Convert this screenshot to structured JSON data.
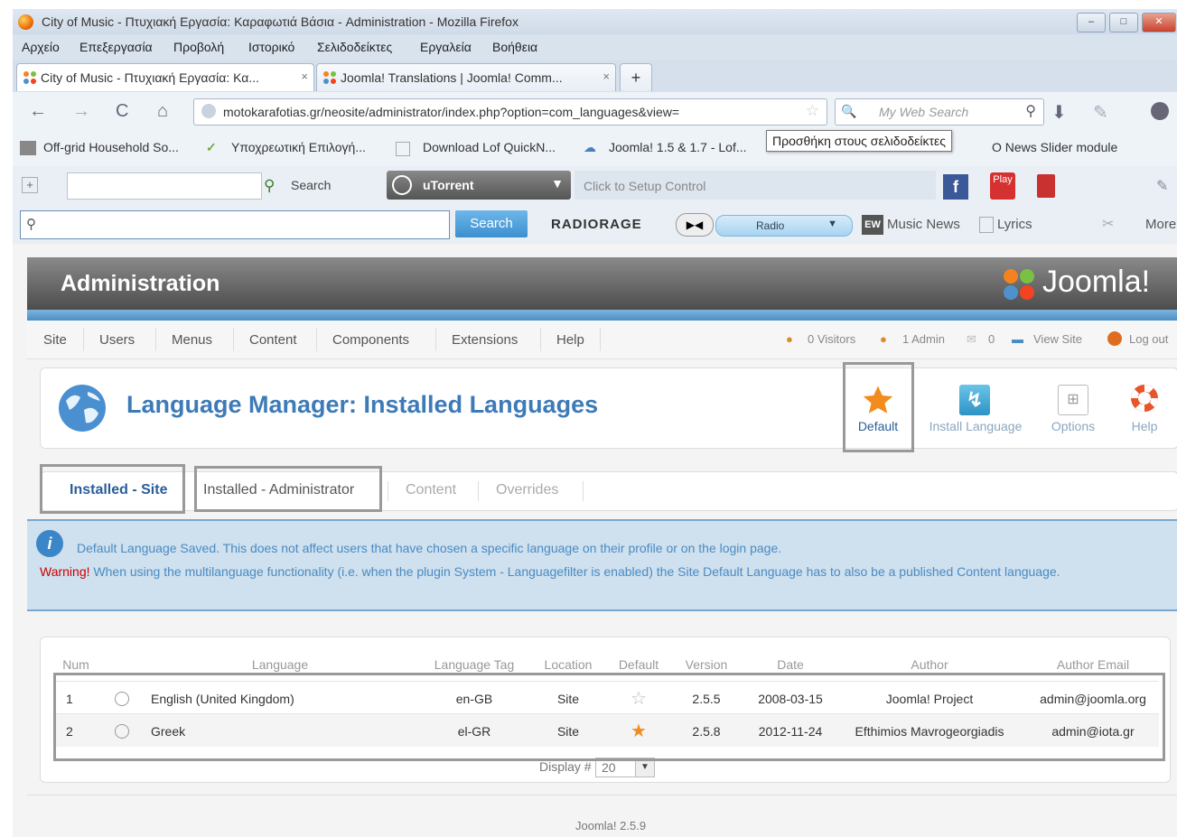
{
  "window": {
    "title": "City of Music - Πτυχιακή Εργασία: Καραφωτιά Βάσια - Administration - Mozilla Firefox"
  },
  "menubar": {
    "items": [
      "Αρχείο",
      "Επεξεργασία",
      "Προβολή",
      "Ιστορικό",
      "Σελιδοδείκτες",
      "Εργαλεία",
      "Βοήθεια"
    ]
  },
  "tabs": [
    {
      "label": "City of Music - Πτυχιακή Εργασία: Κα...",
      "close": "×"
    },
    {
      "label": "Joomla! Translations | Joomla! Comm...",
      "close": "×"
    },
    {
      "label": "+"
    }
  ],
  "navbar": {
    "back_icon": "←",
    "forward_icon": "→",
    "reload_icon": "C",
    "home_icon": "⌂",
    "url": "motokarafotias.gr/neosite/administrator/index.php?option=com_languages&view=",
    "search_placeholder": "My Web Search"
  },
  "bookmarks": {
    "items": [
      "Off-grid Household So...",
      "Υποχρεωτική Επιλογή...",
      "Download Lof QuickN...",
      "Joomla! 1.5 & 1.7 - Lof...",
      "O News Slider module"
    ],
    "tooltip": "Προσθήκη στους σελιδοδείκτες"
  },
  "toolbar1": {
    "search_label": "Search",
    "utorrent_label": "uTorrent",
    "setup_text": "Click to Setup Control",
    "play_label": "Play"
  },
  "toolbar2": {
    "search_button": "Search",
    "radiorage": "RADIORAGE",
    "radio_label": "Radio",
    "music_news": "Music News",
    "lyrics": "Lyrics",
    "more": "More"
  },
  "admin": {
    "header_title": "Administration",
    "logo_text": "Joomla!",
    "menu": [
      "Site",
      "Users",
      "Menus",
      "Content",
      "Components",
      "Extensions",
      "Help"
    ],
    "status": {
      "visitors": "0 Visitors",
      "admin": "1 Admin",
      "messages": "0",
      "view_site": "View Site",
      "logout": "Log out"
    },
    "page_title": "Language Manager: Installed Languages",
    "toolbar": {
      "default": "Default",
      "install": "Install Language",
      "options": "Options",
      "help": "Help"
    },
    "subtabs": [
      "Installed - Site",
      "Installed - Administrator",
      "Content",
      "Overrides"
    ],
    "message": {
      "line1": "Default Language Saved. This does not affect users that have chosen a specific language on their profile or on the login page.",
      "warning_label": "Warning!",
      "line2": " When using the multilanguage functionality (i.e. when the plugin System - Languagefilter is enabled) the Site Default Language has to also be a published Content language."
    },
    "table": {
      "headers": [
        "Num",
        "Language",
        "Language Tag",
        "Location",
        "Default",
        "Version",
        "Date",
        "Author",
        "Author Email"
      ],
      "rows": [
        {
          "num": "1",
          "language": "English (United Kingdom)",
          "tag": "en-GB",
          "location": "Site",
          "default": false,
          "version": "2.5.5",
          "date": "2008-03-15",
          "author": "Joomla! Project",
          "email": "admin@joomla.org"
        },
        {
          "num": "2",
          "language": "Greek",
          "tag": "el-GR",
          "location": "Site",
          "default": true,
          "version": "2.5.8",
          "date": "2012-11-24",
          "author": "Efthimios Mavrogeorgiadis",
          "email": "admin@iota.gr"
        }
      ],
      "display_label": "Display #",
      "display_value": "20"
    },
    "footer": "Joomla! 2.5.9"
  },
  "colors": {
    "title_blue": "#3d7ab8",
    "warning_red": "#cc0000",
    "star_orange": "#f28c1e"
  }
}
